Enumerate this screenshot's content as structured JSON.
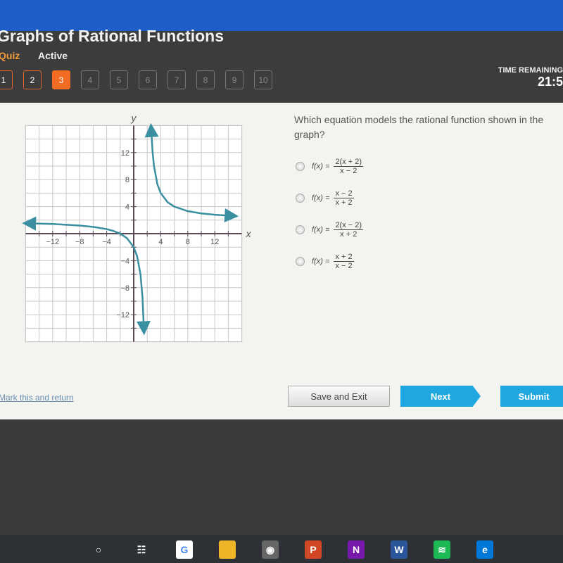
{
  "header": {
    "title": "Graphs of Rational Functions",
    "type": "Quiz",
    "status": "Active",
    "time_label": "TIME REMAINING",
    "time_value": "21:5",
    "questions": [
      "1",
      "2",
      "3",
      "4",
      "5",
      "6",
      "7",
      "8",
      "9",
      "10"
    ],
    "current": "3"
  },
  "question": {
    "text": "Which equation models the rational function shown in the graph?",
    "options": [
      {
        "lhs": "f(x) =",
        "num": "2(x + 2)",
        "den": "x − 2"
      },
      {
        "lhs": "f(x) =",
        "num": "x − 2",
        "den": "x + 2"
      },
      {
        "lhs": "f(x) =",
        "num": "2(x − 2)",
        "den": "x + 2"
      },
      {
        "lhs": "f(x) =",
        "num": "x + 2",
        "den": "x − 2"
      }
    ]
  },
  "footer": {
    "mark": "Mark this and return",
    "save": "Save and Exit",
    "next": "Next",
    "submit": "Submit"
  },
  "colors": {
    "accent": "#f36c24",
    "button": "#1fa8e0",
    "curve": "#3a8fa0",
    "topbar": "#1e5ec8"
  },
  "taskbar": {
    "icons": [
      "cortana-icon",
      "task-view-icon",
      "google-icon",
      "file-explorer-icon",
      "chrome-icon",
      "powerpoint-icon",
      "onenote-icon",
      "word-icon",
      "spotify-icon",
      "edge-icon"
    ]
  },
  "chart_data": {
    "type": "line",
    "xlabel": "x",
    "ylabel": "y",
    "xlim": [
      -16,
      16
    ],
    "ylim": [
      -16,
      16
    ],
    "grid": true,
    "xticks": [
      "−12",
      "−8",
      "−4",
      "4",
      "8",
      "12"
    ],
    "yticks": [
      "12",
      "8",
      "4",
      "−4",
      "−8",
      "−12"
    ],
    "xtick_values": [
      -12,
      -8,
      -4,
      4,
      8,
      12
    ],
    "ytick_values": [
      12,
      8,
      4,
      -4,
      -8,
      -12
    ],
    "series": [
      {
        "x": [
          -15.5,
          -12,
          -8,
          -6,
          -4,
          -3,
          -2,
          -1,
          0,
          0.5,
          1,
          1.3,
          1.5
        ],
        "y": [
          1.52,
          1.43,
          1.2,
          1,
          0.67,
          0.4,
          0,
          -0.67,
          -2,
          -3.33,
          -6,
          -9.43,
          -14
        ]
      },
      {
        "x": [
          2.6,
          2.8,
          3,
          3.5,
          4,
          5,
          6,
          8,
          10,
          12,
          14.5
        ],
        "y": [
          15.33,
          12,
          10,
          7.33,
          6,
          4.67,
          4,
          3.33,
          3,
          2.8,
          2.64
        ]
      }
    ]
  }
}
